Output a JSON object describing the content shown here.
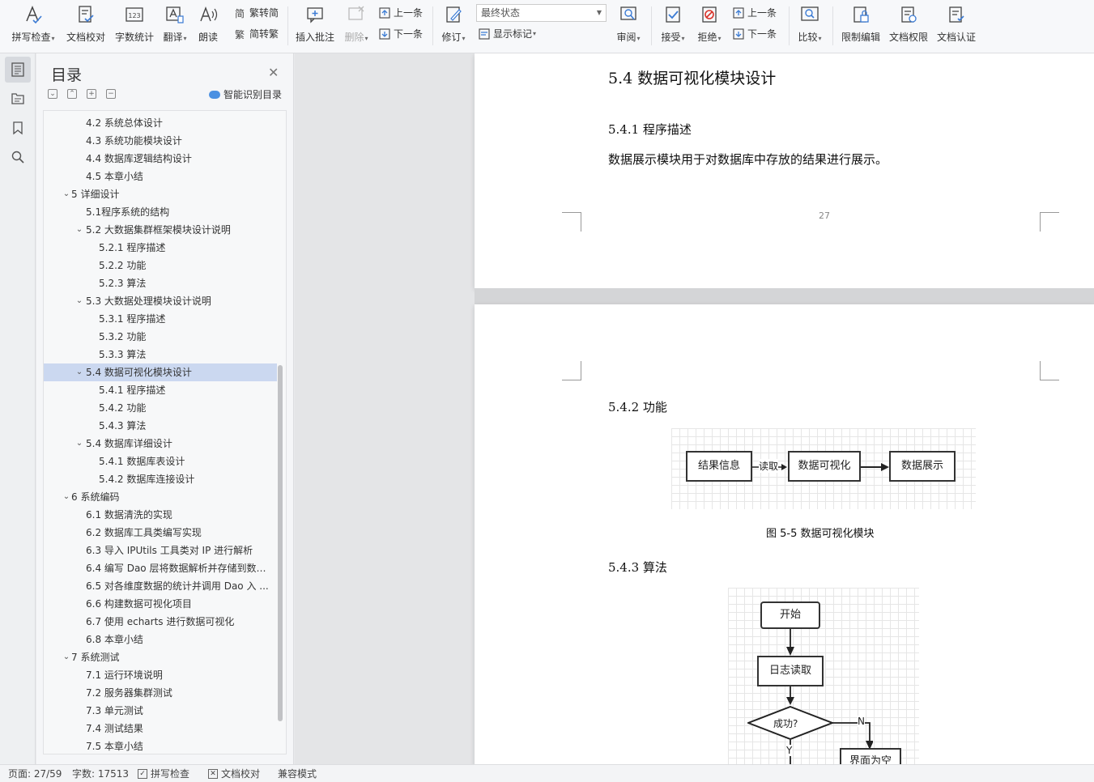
{
  "ribbon": {
    "spell_check": "拼写检查",
    "doc_proofread": "文档校对",
    "word_count": "字数统计",
    "translate": "翻译",
    "read_aloud": "朗读",
    "trad_to_simp": "繁转简",
    "simp_to_trad": "简转繁",
    "insert_comment": "插入批注",
    "delete": "删除",
    "prev_comment": "上一条",
    "next_comment": "下一条",
    "revise": "修订",
    "revision_state": "最终状态",
    "show_markup": "显示标记",
    "review": "审阅",
    "accept": "接受",
    "reject": "拒绝",
    "prev_change": "上一条",
    "next_change": "下一条",
    "compare": "比较",
    "restrict_edit": "限制编辑",
    "doc_permission": "文档权限",
    "doc_certify": "文档认证"
  },
  "toc": {
    "title": "目录",
    "smart_toc": "智能识别目录",
    "items": [
      {
        "label": "4.2  系统总体设计",
        "level": 2
      },
      {
        "label": "4.3  系统功能模块设计",
        "level": 2
      },
      {
        "label": "4.4  数据库逻辑结构设计",
        "level": 2
      },
      {
        "label": "4.5  本章小结",
        "level": 2
      },
      {
        "label": "5    详细设计",
        "level": 1,
        "expand": true
      },
      {
        "label": "5.1程序系统的结构",
        "level": 2
      },
      {
        "label": "5.2    大数据集群框架模块设计说明",
        "level": 2,
        "expand": true
      },
      {
        "label": "5.2.1  程序描述",
        "level": 3
      },
      {
        "label": "5.2.2  功能",
        "level": 3
      },
      {
        "label": "5.2.3  算法",
        "level": 3
      },
      {
        "label": "5.3    大数据处理模块设计说明",
        "level": 2,
        "expand": true
      },
      {
        "label": "5.3.1  程序描述",
        "level": 3
      },
      {
        "label": "5.3.2  功能",
        "level": 3
      },
      {
        "label": "5.3.3  算法",
        "level": 3
      },
      {
        "label": "5.4    数据可视化模块设计",
        "level": 2,
        "expand": true,
        "selected": true
      },
      {
        "label": "5.4.1  程序描述",
        "level": 3
      },
      {
        "label": "5.4.2  功能",
        "level": 3
      },
      {
        "label": "5.4.3  算法",
        "level": 3
      },
      {
        "label": "5.4    数据库详细设计",
        "level": 2,
        "expand": true
      },
      {
        "label": "5.4.1  数据库表设计",
        "level": 3
      },
      {
        "label": "5.4.2  数据库连接设计",
        "level": 3
      },
      {
        "label": "6    系统编码",
        "level": 1,
        "expand": true
      },
      {
        "label": "6.1  数据清洗的实现",
        "level": 2
      },
      {
        "label": "6.2  数据库工具类编写实现",
        "level": 2
      },
      {
        "label": "6.3 导入 IPUtils 工具类对 IP 进行解析",
        "level": 2
      },
      {
        "label": "6.4 编写 Dao 层将数据解析并存储到数据 ...",
        "level": 2
      },
      {
        "label": "6.5  对各维度数据的统计并调用 Dao 入 ...",
        "level": 2
      },
      {
        "label": "6.6  构建数据可视化项目",
        "level": 2
      },
      {
        "label": "6.7  使用 echarts 进行数据可视化",
        "level": 2
      },
      {
        "label": "6.8  本章小结",
        "level": 2
      },
      {
        "label": "7    系统测试",
        "level": 1,
        "expand": true
      },
      {
        "label": "7.1  运行环境说明",
        "level": 2
      },
      {
        "label": "7.2  服务器集群测试",
        "level": 2
      },
      {
        "label": "7.3  单元测试",
        "level": 2
      },
      {
        "label": "7.4  测试结果",
        "level": 2
      },
      {
        "label": "7.5  本章小结",
        "level": 2
      }
    ]
  },
  "document": {
    "section_heading": "5.4    数据可视化模块设计",
    "sub_541": "5.4.1  程序描述",
    "body_541": "数据展示模块用于对数据库中存放的结果进行展示。",
    "page_number": "27",
    "sub_542": "5.4.2  功能",
    "flow1": {
      "box1": "结果信息",
      "arrow_label": "读取",
      "box2": "数据可视化",
      "box3": "数据展示"
    },
    "fig_caption": "图 5-5  数据可视化模块",
    "sub_543": "5.4.3  算法",
    "flow2": {
      "start": "开始",
      "log_read": "日志读取",
      "decision": "成功?",
      "no_label": "N",
      "yes_label": "Y",
      "empty_ui": "界面为空"
    }
  },
  "status": {
    "page": "页面: 27/59",
    "word_count": "字数: 17513",
    "spell_check": "拼写检查",
    "doc_proofread": "文档校对",
    "compat_mode": "兼容模式"
  }
}
